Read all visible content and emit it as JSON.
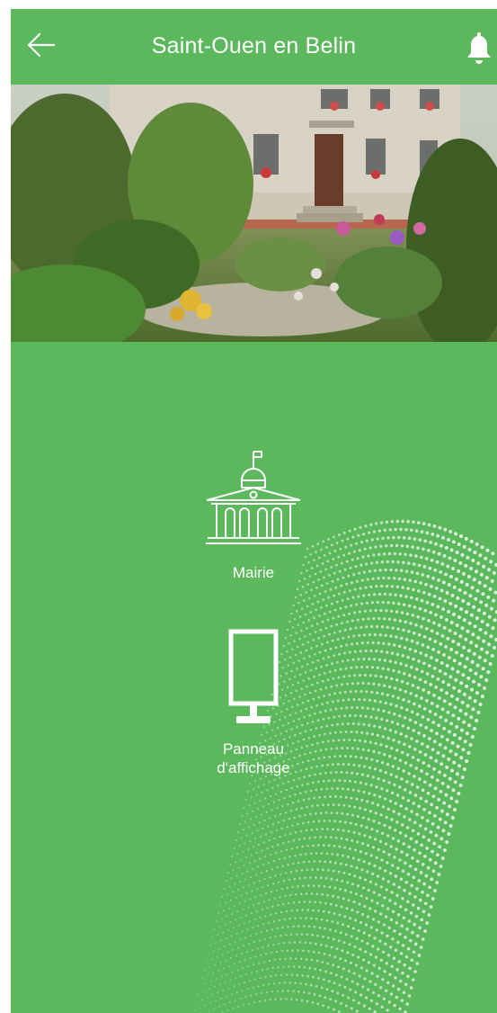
{
  "header": {
    "title": "Saint-Ouen en Belin",
    "back_icon": "arrow-left-icon",
    "notification_icon": "bell-icon"
  },
  "hero": {
    "image": "town-hall-garden-photo"
  },
  "menu": {
    "items": [
      {
        "label": "Mairie",
        "icon": "town-hall-icon"
      },
      {
        "label": "Panneau d'affichage",
        "icon": "notice-board-icon"
      }
    ]
  },
  "colors": {
    "primary": "#5cb85c",
    "text": "#ffffff"
  }
}
